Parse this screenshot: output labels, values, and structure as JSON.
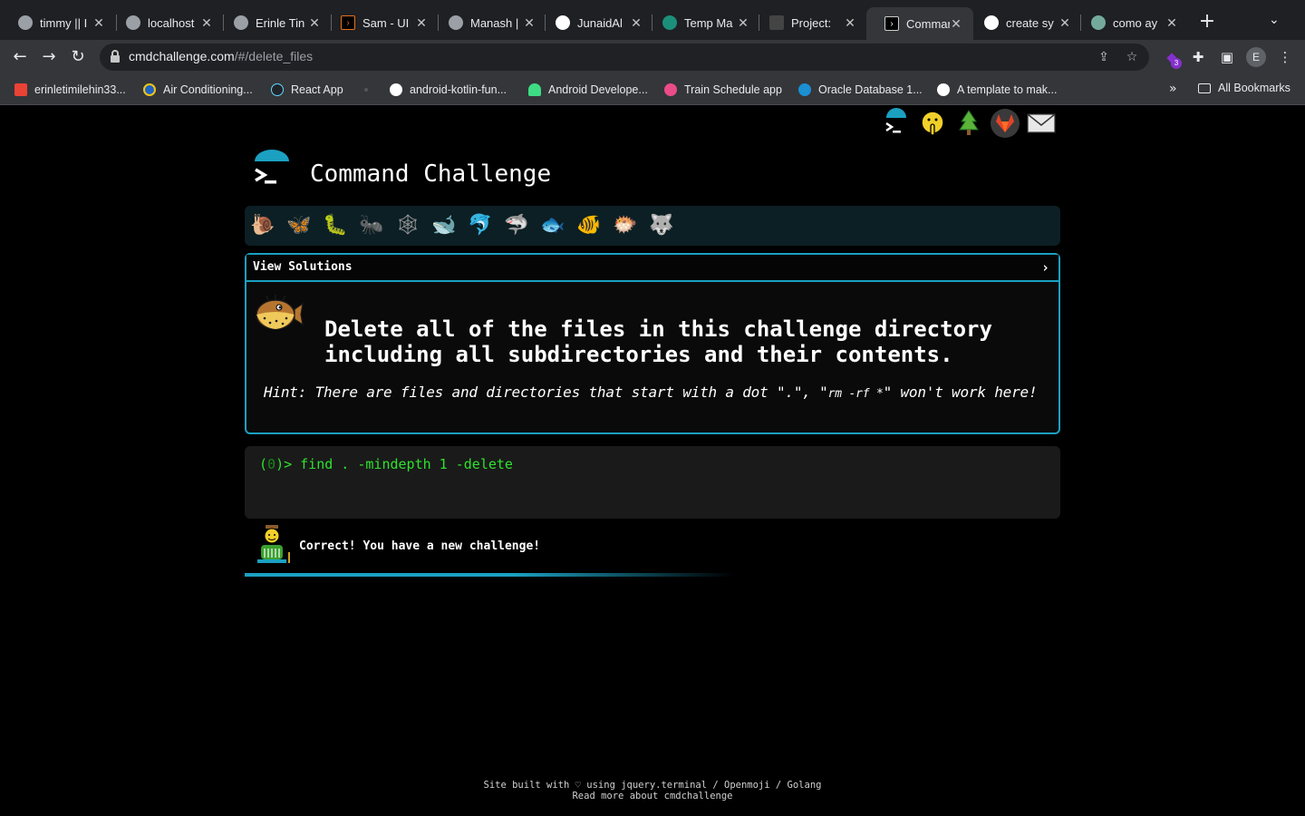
{
  "browser": {
    "tabs": [
      {
        "title": "timmy || I",
        "favicon": "globe-icon"
      },
      {
        "title": "localhost",
        "favicon": "globe-icon"
      },
      {
        "title": "Erinle Tin",
        "favicon": "globe-icon"
      },
      {
        "title": "Sam - UI",
        "favicon": "terminal-icon"
      },
      {
        "title": "Manash |",
        "favicon": "globe-icon"
      },
      {
        "title": "JunaidAl",
        "favicon": "github-icon"
      },
      {
        "title": "Temp Ma",
        "favicon": "tempmail-icon"
      },
      {
        "title": "Project:",
        "favicon": "project-icon"
      },
      {
        "title": "Comman",
        "favicon": "terminal-icon",
        "active": true
      },
      {
        "title": "create sy",
        "favicon": "google-icon"
      },
      {
        "title": "como ay",
        "favicon": "chatgpt-icon"
      }
    ],
    "url_host": "cmdchallenge.com",
    "url_path": "/#/delete_files",
    "extension_badge": "3",
    "profile_initial": "E",
    "bookmarks": [
      "erinletimilehin33...",
      "Air Conditioning...",
      "React App",
      "",
      "android-kotlin-fun...",
      "Android Develope...",
      "Train Schedule app",
      "Oracle Database 1...",
      "A template to mak..."
    ],
    "bookmarks_more": "»",
    "all_bookmarks": "All Bookmarks"
  },
  "site": {
    "title": "Command Challenge",
    "panel_label": "View Solutions",
    "panel_chevron": "›",
    "task": "Delete all of the files in this challenge directory including all subdirectories and their contents.",
    "hint_prefix": "Hint: There are files and directories that start with a dot \".\", \"",
    "hint_code": "rm -rf *",
    "hint_suffix": "\" won't work here!",
    "prompt_open": "(",
    "prompt_num": "0",
    "prompt_close": ")> ",
    "command": "find . -mindepth 1 -delete",
    "result": "Correct! You have a new challenge!",
    "progress": 0.55,
    "footer_line1": "Site built with ♡ using jquery.terminal / Openmoji / Golang",
    "footer_line2": "Read more about cmdchallenge",
    "accent_color": "#1ba0c2",
    "prompt_color": "#2ee22e",
    "levels": [
      "snail-icon",
      "butterfly-icon",
      "caterpillar-icon",
      "ant-icon",
      "spider-web-icon",
      "whale-icon",
      "dolphin-icon",
      "shark-icon",
      "fish-icon",
      "tropical-fish-icon",
      "blowfish-icon",
      "wolf-icon"
    ],
    "header_links": [
      "terminal-logo-icon",
      "shushing-face-icon",
      "tree-icon",
      "gitlab-icon",
      "envelope-icon"
    ]
  }
}
